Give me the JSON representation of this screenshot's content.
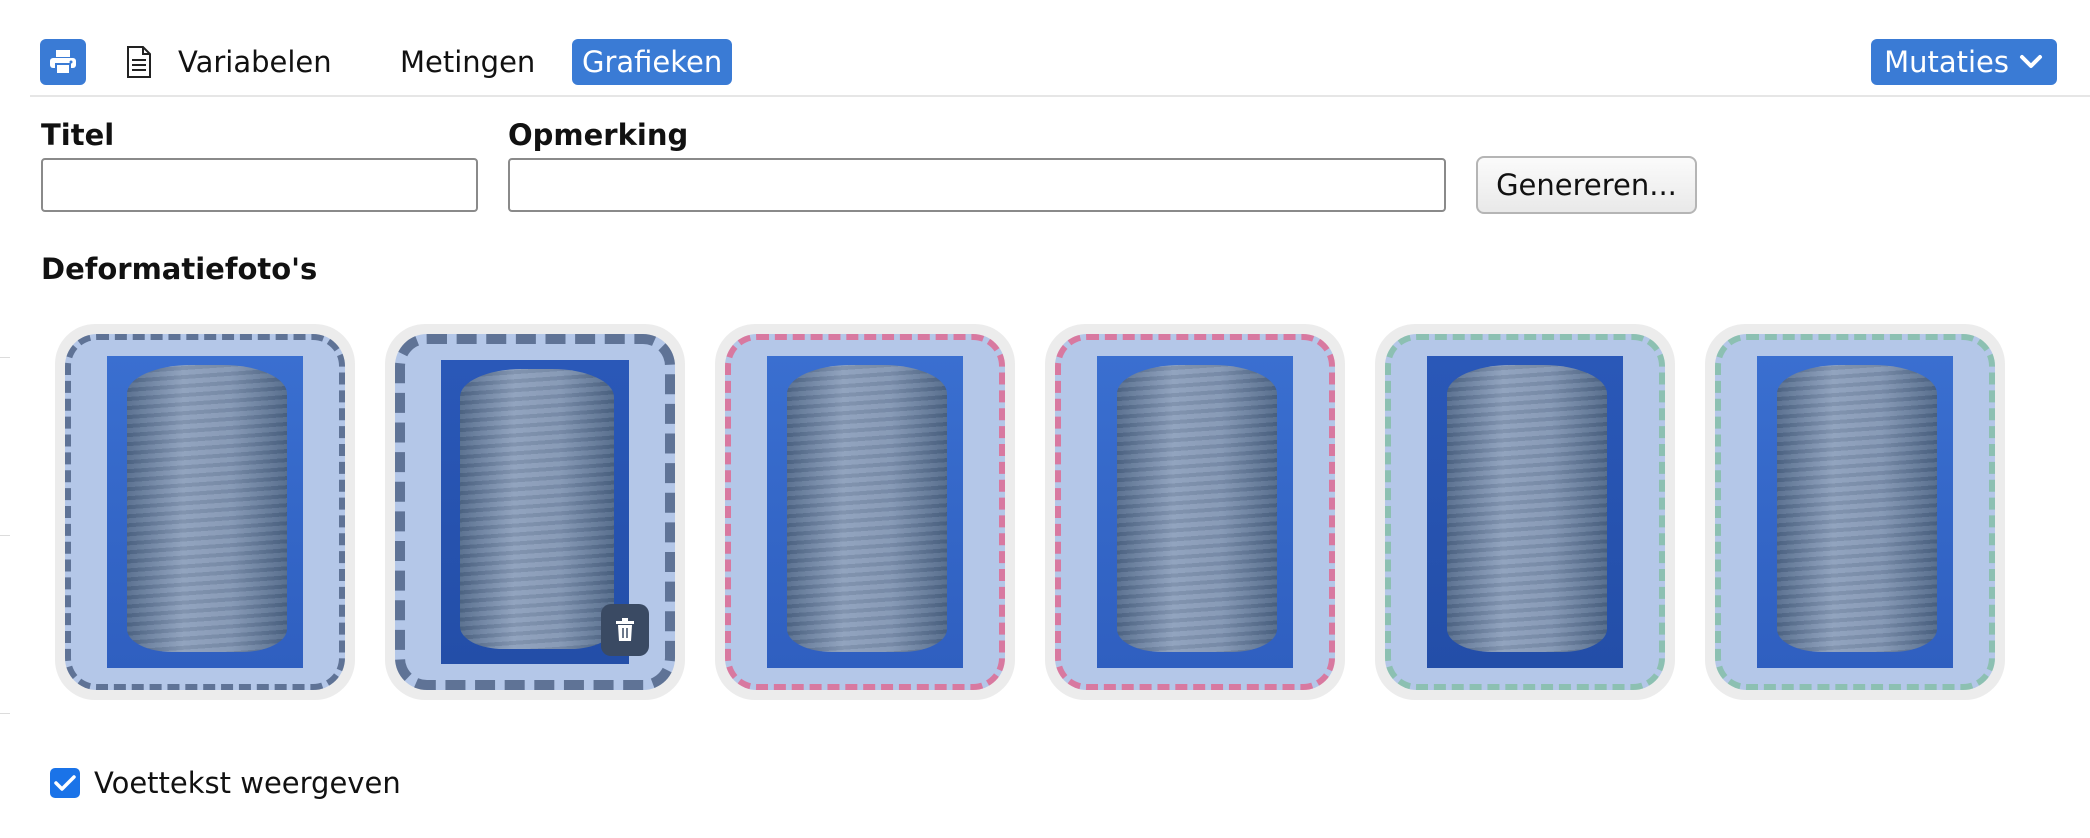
{
  "toolbar": {
    "print_icon": "print-icon",
    "document_icon": "document-icon",
    "tabs": [
      {
        "label": "Variabelen"
      },
      {
        "label": "Metingen"
      },
      {
        "label": "Grafieken",
        "active": true
      }
    ],
    "mutaties_label": "Mutaties",
    "accent_color": "#3a7bd5"
  },
  "form": {
    "titel_label": "Titel",
    "titel_value": "",
    "opmerking_label": "Opmerking",
    "opmerking_value": "",
    "generate_button": "Genereren..."
  },
  "photos": {
    "section_title": "Deformatiefoto's",
    "items": [
      {
        "border_color": "#5f7396",
        "border_style": "dashed"
      },
      {
        "border_color": "#5f7396",
        "border_style": "dashed-thick",
        "has_delete": true,
        "delete_icon": "trash-icon"
      },
      {
        "border_color": "#d879a0",
        "border_style": "dashed"
      },
      {
        "border_color": "#d879a0",
        "border_style": "dashed"
      },
      {
        "border_color": "#8cc0b2",
        "border_style": "dashed"
      },
      {
        "border_color": "#8cc0b2",
        "border_style": "dashed"
      }
    ]
  },
  "footer": {
    "checkbox_label": "Voettekst weergeven",
    "checked": true
  }
}
